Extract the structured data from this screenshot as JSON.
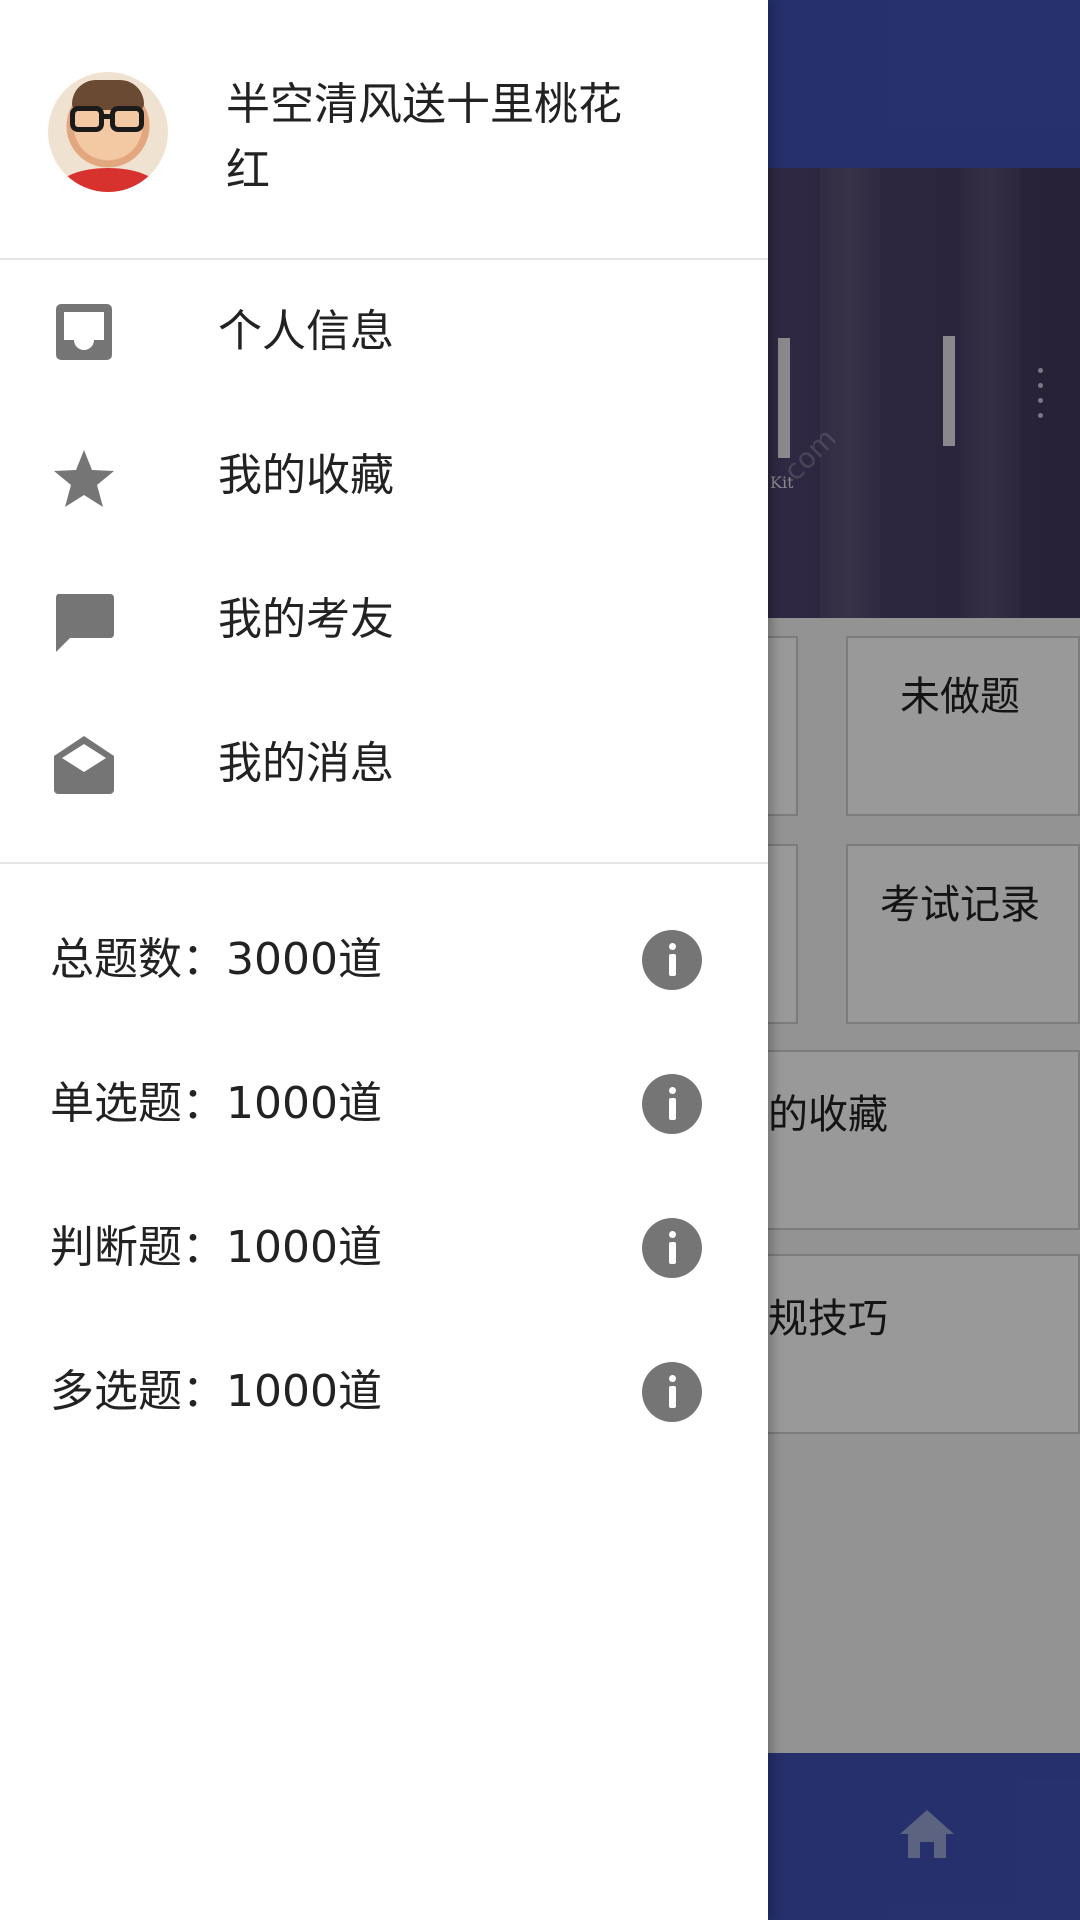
{
  "background_app": {
    "tiles": [
      {
        "label": "未做题"
      },
      {
        "label": "考试记录"
      },
      {
        "label": "的收藏"
      },
      {
        "label": "规技巧"
      }
    ],
    "banner_caption": "Kit",
    "banner_watermark": "com",
    "colors": {
      "primary": "#3f51b5",
      "banner": "#4f4470"
    }
  },
  "drawer": {
    "profile": {
      "avatar": "child-with-glasses-photo",
      "name": "半空清风送十里桃花红"
    },
    "menu": [
      {
        "icon": "inbox-icon",
        "label": "个人信息"
      },
      {
        "icon": "star-icon",
        "label": "我的收藏"
      },
      {
        "icon": "chat-bubble-icon",
        "label": "我的考友"
      },
      {
        "icon": "open-mail-icon",
        "label": "我的消息"
      }
    ],
    "stats": [
      {
        "text": "总题数：3000道",
        "icon": "info-icon"
      },
      {
        "text": "单选题：1000道",
        "icon": "info-icon"
      },
      {
        "text": "判断题：1000道",
        "icon": "info-icon"
      },
      {
        "text": "多选题：1000道",
        "icon": "info-icon"
      }
    ]
  },
  "colors": {
    "drawer_bg": "#ffffff",
    "icon_gray": "#757575",
    "text": "#222222",
    "divider": "#e6e6e6"
  }
}
